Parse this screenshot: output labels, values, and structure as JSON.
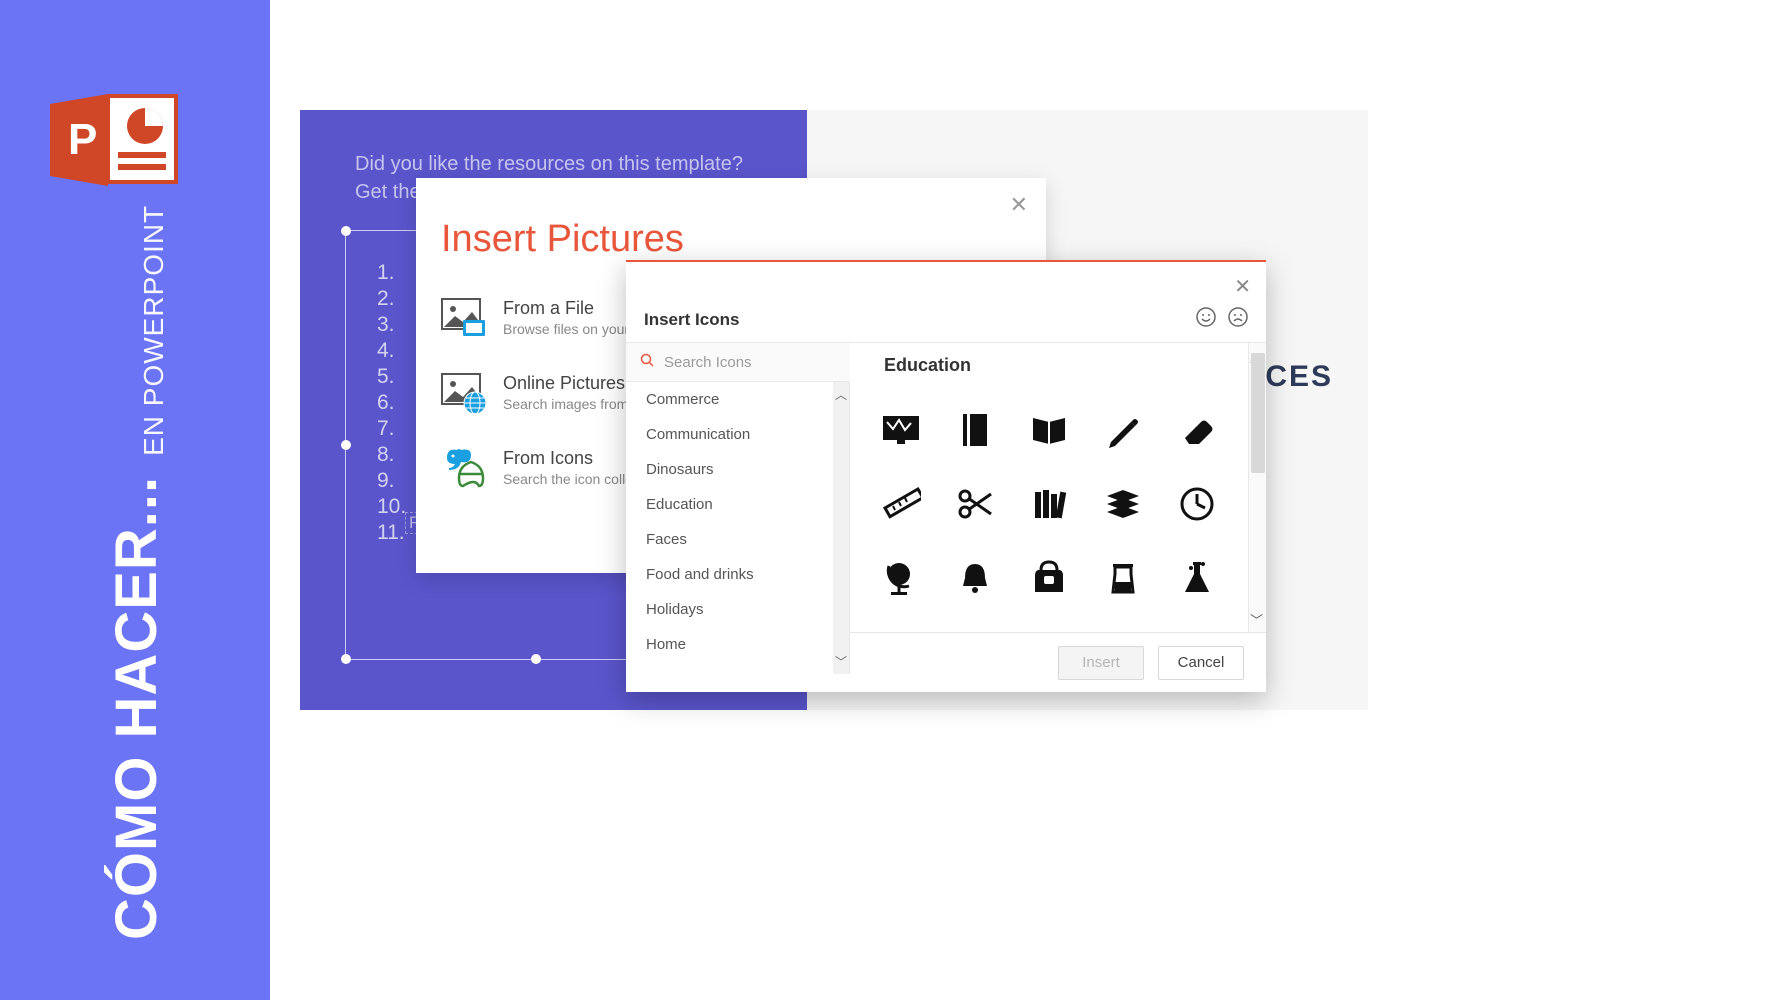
{
  "sidebar": {
    "title_big": "CÓMO HACER...",
    "title_small": "EN POWERPOINT"
  },
  "slide": {
    "hint_text": "Did you like the resources on this template? Get them for free at our other websites",
    "numbers": [
      "1.",
      "2.",
      "3.",
      "4.",
      "5.",
      "6.",
      "7.",
      "8.",
      "9.",
      "10.",
      "11."
    ],
    "flat_chip": "Flat business landing page c",
    "right_partial": "URCES"
  },
  "insert_pictures": {
    "title": "Insert Pictures",
    "options": [
      {
        "title": "From a File",
        "desc": "Browse files on your c"
      },
      {
        "title": "Online Pictures",
        "desc": "Search images from o"
      },
      {
        "title": "From Icons",
        "desc": "Search the icon collec"
      }
    ]
  },
  "insert_icons": {
    "header": "Insert Icons",
    "search_placeholder": "Search Icons",
    "categories": [
      "Commerce",
      "Communication",
      "Dinosaurs",
      "Education",
      "Faces",
      "Food and drinks",
      "Holidays",
      "Home"
    ],
    "selected_category": "Education",
    "icons": [
      "blackboard",
      "notebook",
      "open-book",
      "pencil",
      "eraser",
      "ruler",
      "scissors",
      "library",
      "stacked-books",
      "clock",
      "globe",
      "bell",
      "backpack",
      "beaker",
      "flask"
    ],
    "btn_insert": "Insert",
    "btn_cancel": "Cancel"
  }
}
